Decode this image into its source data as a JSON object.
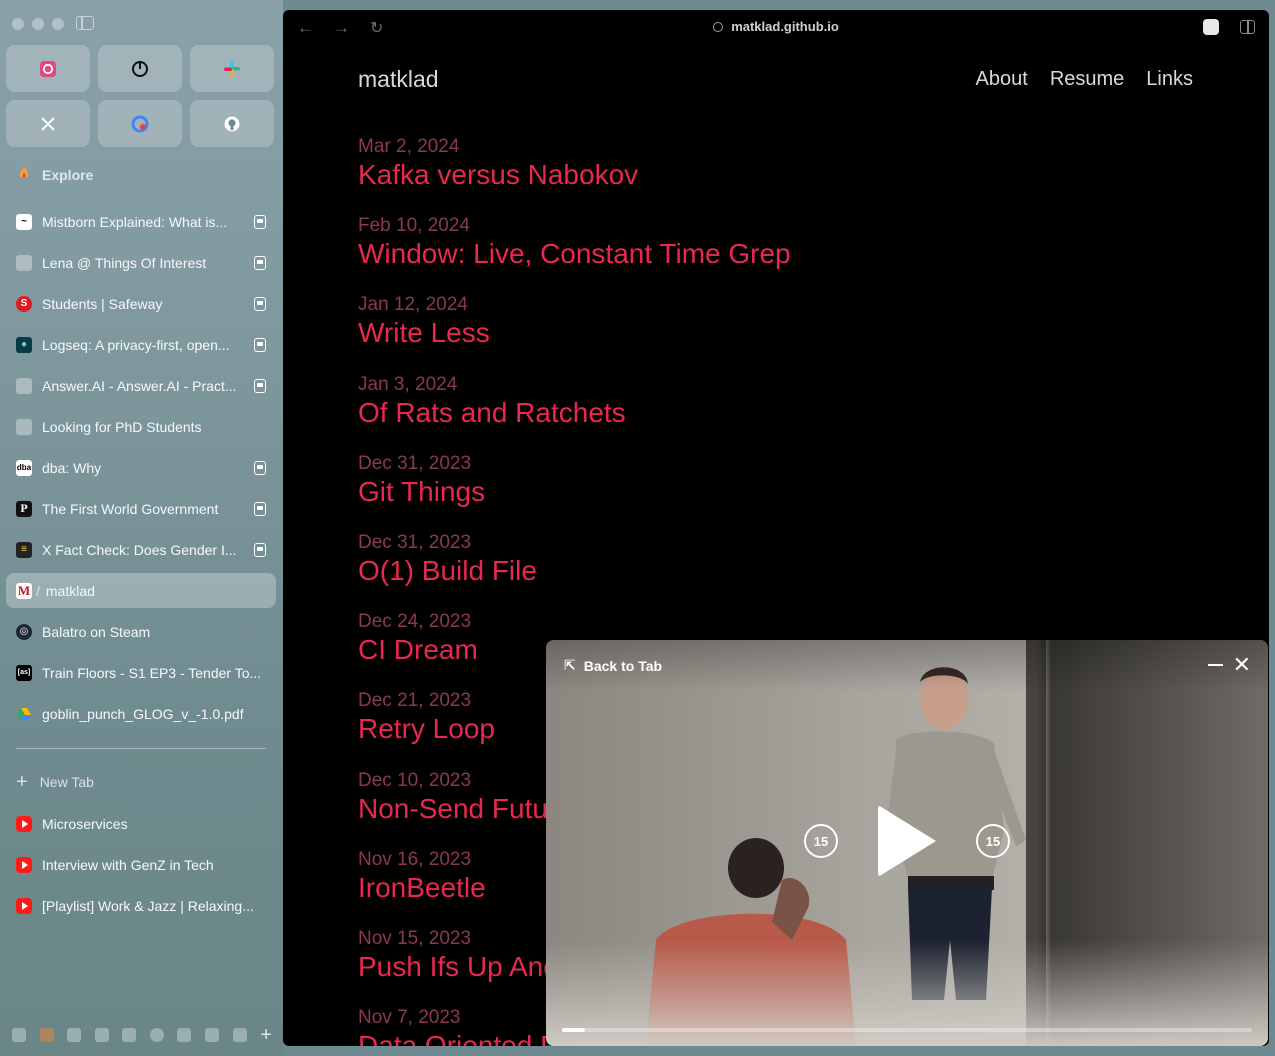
{
  "window": {
    "url": "matklad.github.io"
  },
  "sidebar": {
    "explore_label": "Explore",
    "pinned": [
      {
        "name": "pin-app-1",
        "icon": "camera-icon"
      },
      {
        "name": "pin-app-2",
        "icon": "power-icon"
      },
      {
        "name": "pin-slack",
        "icon": "slack-icon"
      },
      {
        "name": "pin-x",
        "icon": "x-logo-icon"
      },
      {
        "name": "pin-google",
        "icon": "google-icon"
      },
      {
        "name": "pin-github",
        "icon": "github-icon"
      }
    ],
    "tabs": [
      {
        "label": "Mistborn Explained: What is...",
        "audio": true
      },
      {
        "label": "Lena @ Things Of Interest",
        "audio": true
      },
      {
        "label": "Students | Safeway",
        "audio": true
      },
      {
        "label": "Logseq: A privacy-first, open...",
        "audio": true
      },
      {
        "label": "Answer.AI - Answer.AI - Pract...",
        "audio": true
      },
      {
        "label": "Looking for PhD Students",
        "audio": false
      },
      {
        "label": "dba: Why",
        "audio": true
      },
      {
        "label": "The First World Government",
        "audio": true
      },
      {
        "label": "X Fact Check: Does Gender I...",
        "audio": true
      },
      {
        "label": "matklad",
        "audio": false,
        "active": true
      },
      {
        "label": "Balatro on Steam",
        "audio": false
      },
      {
        "label": "Train Floors - S1 EP3 - Tender To...",
        "audio": false
      },
      {
        "label": "goblin_punch_GLOG_v_-1.0.pdf",
        "audio": false
      }
    ],
    "new_tab_label": "New Tab",
    "tabs_below": [
      {
        "label": "Microservices"
      },
      {
        "label": "Interview with GenZ in Tech"
      },
      {
        "label": "[Playlist] Work & Jazz | Relaxing..."
      }
    ]
  },
  "site": {
    "title": "matklad",
    "nav": [
      "About",
      "Resume",
      "Links"
    ],
    "posts": [
      {
        "date": "Mar 2, 2024",
        "title": "Kafka versus Nabokov"
      },
      {
        "date": "Feb 10, 2024",
        "title": "Window: Live, Constant Time Grep"
      },
      {
        "date": "Jan 12, 2024",
        "title": "Write Less"
      },
      {
        "date": "Jan 3, 2024",
        "title": "Of Rats and Ratchets"
      },
      {
        "date": "Dec 31, 2023",
        "title": "Git Things"
      },
      {
        "date": "Dec 31, 2023",
        "title": "O(1) Build File"
      },
      {
        "date": "Dec 24, 2023",
        "title": "CI Dream"
      },
      {
        "date": "Dec 21, 2023",
        "title": "Retry Loop"
      },
      {
        "date": "Dec 10, 2023",
        "title": "Non-Send Futures"
      },
      {
        "date": "Nov 16, 2023",
        "title": "IronBeetle"
      },
      {
        "date": "Nov 15, 2023",
        "title": "Push Ifs Up And Fors Down"
      },
      {
        "date": "Nov 7, 2023",
        "title": "Data Oriented Parallel Value Interner"
      }
    ]
  },
  "pip": {
    "back_label": "Back to Tab",
    "skip_seconds": "15",
    "progress": 0.034
  },
  "colors": {
    "post_title": "#e8284e",
    "post_date": "#8a3a4c",
    "site_text": "#d9d9d9"
  }
}
